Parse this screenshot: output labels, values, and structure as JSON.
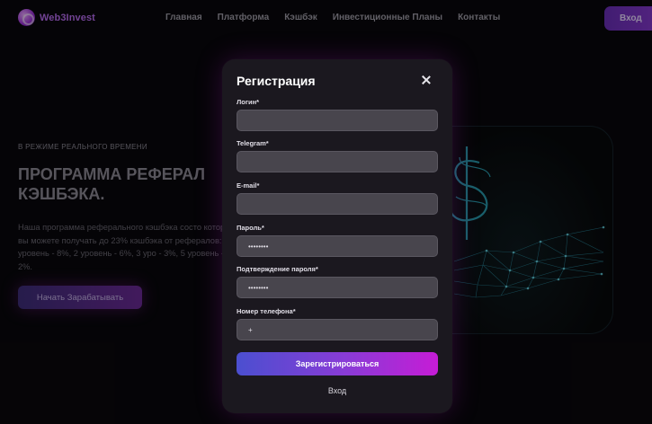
{
  "brand": {
    "name": "Web3Invest"
  },
  "nav": {
    "items": [
      "Главная",
      "Платформа",
      "Кэшбэк",
      "Инвестиционные Планы",
      "Контакты"
    ]
  },
  "header": {
    "login_label": "Вход"
  },
  "hero": {
    "eyebrow": "В РЕЖИМЕ РЕАЛЬНОГО ВРЕМЕНИ",
    "title": "ПРОГРАММА РЕФЕРАЛ КЭШБЭКА.",
    "description": "Наша программа реферального кэшбэка состо которых вы можете получать до 23% кэшбэка от рефералов: 1 уровень - 8%, 2 уровень - 6%, 3 уро - 3%, 5 уровень - 2%.",
    "cta_label": "Начать Зарабатывать"
  },
  "modal": {
    "title": "Регистрация",
    "fields": [
      {
        "label": "Логин*",
        "value": ""
      },
      {
        "label": "Telegram*",
        "value": ""
      },
      {
        "label": "E-mail*",
        "value": ""
      },
      {
        "label": "Пароль*",
        "value": "••••••••"
      },
      {
        "label": "Подтверждение пароля*",
        "value": "••••••••"
      },
      {
        "label": "Номер телефона*",
        "value": "+"
      }
    ],
    "submit_label": "Зарегистрироваться",
    "login_link": "Вход"
  },
  "colors": {
    "accent": "#8a3ad1",
    "accent_pink": "#c61cd6",
    "modal_bg": "#1b181f",
    "field_bg": "#48454d"
  }
}
